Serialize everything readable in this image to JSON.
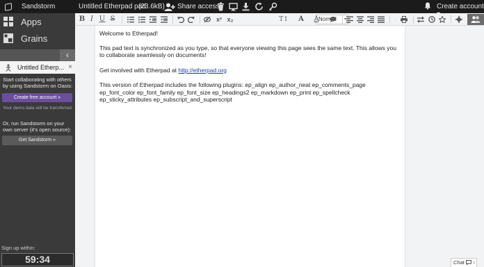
{
  "topbar": {
    "brand": "Sandstorm",
    "title": "Untitled Etherpad pad",
    "size": "(23.6kB)",
    "share_label": "Share access",
    "account_label": "Create account ▾"
  },
  "sidebar": {
    "apps_label": "Apps",
    "grains_label": "Grains",
    "collapse_glyph": "‹",
    "grain_title": "Untitled Etherp...",
    "grain_close": "×",
    "promo_text": "Start collaborating with others by using Sandstorm on Oasis:",
    "create_btn": "Create free account »",
    "demo_note": "Your demo data will be transferred.",
    "promo2_text": "Or, run Sandstorm on your own server (it's open source):",
    "get_btn": "Get Sandstorm »",
    "signup_label": "Sign up within:",
    "timer": "59:34"
  },
  "toolbar": {
    "bold": "B",
    "italic": "I",
    "underline": "U",
    "strike": "S",
    "superscript": "x²",
    "subscript": "x₂",
    "heading_value": "Normal",
    "font_size_glyph": "T↕",
    "font_glyph": "A",
    "font_color_glyph": "A"
  },
  "icons": {
    "toolbar": [
      "ordered-list-icon",
      "unordered-list-icon",
      "indent-icon",
      "outdent-icon",
      "undo-icon",
      "redo-icon",
      "clear-authorship-icon",
      "comment-icon",
      "align-left-icon",
      "align-center-icon",
      "align-right-icon",
      "align-justify-icon",
      "print-icon",
      "import-export-icon",
      "timeslider-icon",
      "star-icon",
      "settings-icon",
      "users-icon"
    ]
  },
  "editor": {
    "line1": "Welcome to Etherpad!",
    "line2": "This pad text is synchronized as you type, so that everyone viewing this page sees the same text. This allows you to collaborate seamlessly on documents!",
    "line3_prefix": "Get involved with Etherpad at ",
    "line3_link": "http://etherpad.org",
    "line4": "This version of Etherpad includes the following plugins: ep_align ep_author_neat ep_comments_page ep_font_color ep_font_family ep_font_size ep_headings2 ep_markdown ep_print ep_spellcheck ep_sticky_attributes ep_subscript_and_superscript"
  },
  "chat": {
    "label": "Chat",
    "count": "0"
  },
  "colors": {
    "topbar": "#1b1b1b",
    "sidebar": "#3a3a3a",
    "create_button": "#6a4e9a",
    "link": "#1a3ea8"
  }
}
